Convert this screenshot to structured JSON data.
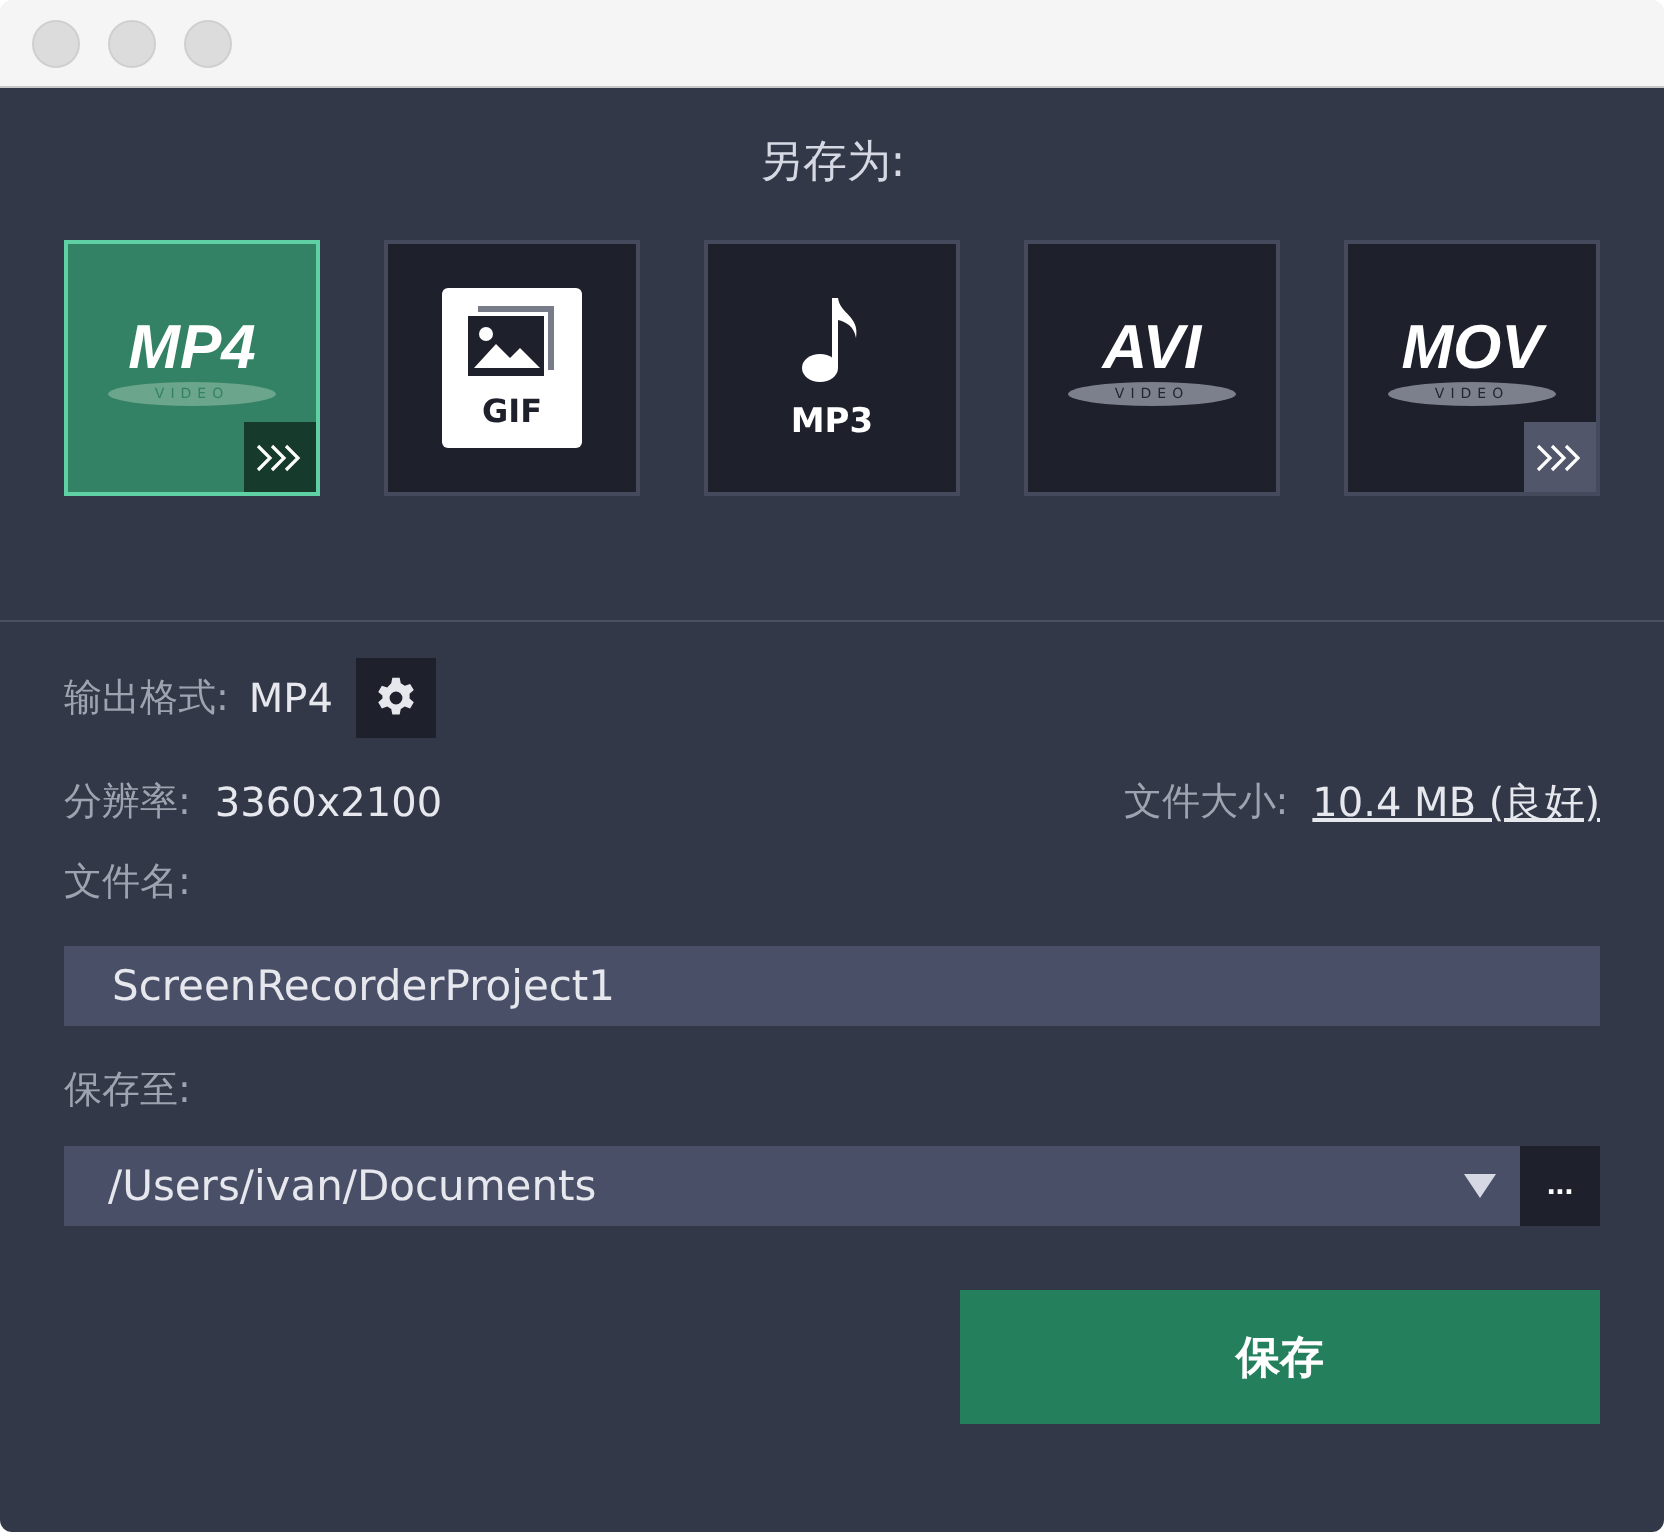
{
  "title": "另存为:",
  "formats": [
    {
      "kind": "video",
      "label": "MP4",
      "sublabel": "VIDEO",
      "selected": true,
      "has_more": true
    },
    {
      "kind": "gif",
      "label": "GIF",
      "selected": false,
      "has_more": false
    },
    {
      "kind": "audio",
      "label": "MP3",
      "selected": false,
      "has_more": false
    },
    {
      "kind": "video",
      "label": "AVI",
      "sublabel": "VIDEO",
      "selected": false,
      "has_more": false
    },
    {
      "kind": "video",
      "label": "MOV",
      "sublabel": "VIDEO",
      "selected": false,
      "has_more": true
    }
  ],
  "output_format": {
    "label": "输出格式:",
    "value": "MP4"
  },
  "resolution": {
    "label": "分辨率:",
    "value": "3360x2100"
  },
  "file_size": {
    "label": "文件大小:",
    "value": "10.4 MB (良好)"
  },
  "file_name": {
    "label": "文件名:",
    "value": "ScreenRecorderProject1"
  },
  "save_to": {
    "label": "保存至:",
    "value": "/Users/ivan/Documents",
    "browse": "..."
  },
  "save_button": "保存"
}
